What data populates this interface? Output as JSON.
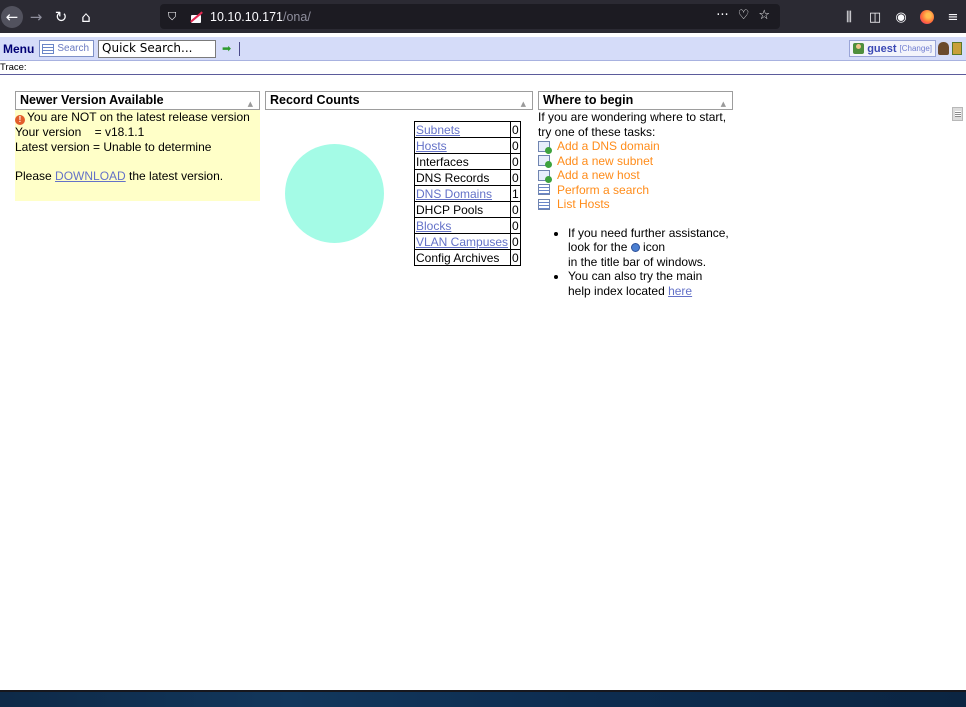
{
  "browser": {
    "url_host": "10.10.10.171",
    "url_path": "/ona/",
    "page_actions": "···"
  },
  "menubar": {
    "menu_label": "Menu",
    "search_label": "Search",
    "quick_search_value": "Quick Search...",
    "user_name": "guest",
    "user_change": "[Change]"
  },
  "trace_label": "Trace:",
  "newer_version": {
    "title": "Newer Version Available",
    "warning": "You are NOT on the latest release version",
    "your_version": "Your version    = v18.1.1",
    "latest_version": "Latest version = Unable to determine",
    "please": "Please ",
    "download": "DOWNLOAD",
    "after": " the latest version."
  },
  "record_counts": {
    "title": "Record Counts",
    "rows": [
      {
        "name": "Subnets",
        "count": "0",
        "link": true
      },
      {
        "name": "Hosts",
        "count": "0",
        "link": true
      },
      {
        "name": "Interfaces",
        "count": "0",
        "link": false
      },
      {
        "name": "DNS Records",
        "count": "0",
        "link": false
      },
      {
        "name": "DNS Domains",
        "count": "1",
        "link": true
      },
      {
        "name": "DHCP Pools",
        "count": "0",
        "link": false
      },
      {
        "name": "Blocks",
        "count": "0",
        "link": true
      },
      {
        "name": "VLAN Campuses",
        "count": "0",
        "link": true
      },
      {
        "name": "Config Archives",
        "count": "0",
        "link": false
      }
    ],
    "pie_color": "#a4fbe6"
  },
  "where_to_begin": {
    "title": "Where to begin",
    "intro1": "If you are wondering where to start,",
    "intro2": "try one of these tasks:",
    "tasks": [
      {
        "label": "Add a DNS domain",
        "icon": "add-doc-icon"
      },
      {
        "label": "Add a new subnet",
        "icon": "add-doc-icon"
      },
      {
        "label": "Add a new host",
        "icon": "add-doc-icon"
      },
      {
        "label": "Perform a search",
        "icon": "search-list-icon"
      },
      {
        "label": "List Hosts",
        "icon": "list-icon"
      }
    ],
    "tip1_a": "If you need further assistance,",
    "tip1_b": "look for the",
    "tip1_c": " icon",
    "tip1_d": "in the title bar of windows.",
    "tip2_a": "You can also try the main",
    "tip2_b": "help index located ",
    "tip2_link": "here"
  },
  "colors": {
    "menubar_bg": "#d5dcf9",
    "notice_bg": "#ffffc8",
    "task_link": "#ff8c1a",
    "link": "#6472c8"
  }
}
